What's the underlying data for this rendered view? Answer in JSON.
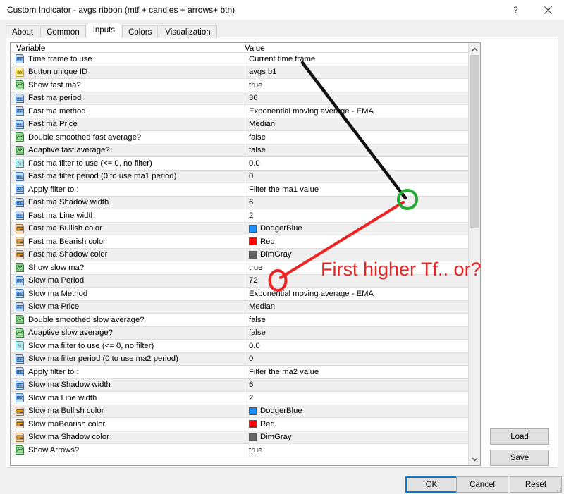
{
  "window": {
    "title": "Custom Indicator - avgs ribbon (mtf + candles + arrows+ btn)",
    "help_label": "?",
    "close_label": "×"
  },
  "tabs": [
    {
      "label": "About",
      "active": false
    },
    {
      "label": "Common",
      "active": false
    },
    {
      "label": "Inputs",
      "active": true
    },
    {
      "label": "Colors",
      "active": false
    },
    {
      "label": "Visualization",
      "active": false
    }
  ],
  "grid": {
    "headers": {
      "variable": "Variable",
      "value": "Value"
    },
    "rows": [
      {
        "icon": "int-123-icon",
        "label": "Time frame to use",
        "value": "Current time frame"
      },
      {
        "icon": "string-ab-icon",
        "label": "Button unique ID",
        "value": "avgs b1"
      },
      {
        "icon": "bool-chart-icon",
        "label": "Show fast ma?",
        "value": "true"
      },
      {
        "icon": "int-123-icon",
        "label": "Fast ma period",
        "value": "36"
      },
      {
        "icon": "int-123-icon",
        "label": "Fast ma method",
        "value": "Exponential moving average - EMA"
      },
      {
        "icon": "int-123-icon",
        "label": "Fast ma Price",
        "value": "Median"
      },
      {
        "icon": "bool-chart-icon",
        "label": "Double smoothed fast average?",
        "value": "false"
      },
      {
        "icon": "bool-chart-icon",
        "label": "Adaptive fast average?",
        "value": "false"
      },
      {
        "icon": "double-half-icon",
        "label": "Fast ma filter to use (<= 0, no filter)",
        "value": "0.0"
      },
      {
        "icon": "int-123-icon",
        "label": "Fast ma filter period (0 to use ma1 period)",
        "value": "0"
      },
      {
        "icon": "int-123-icon",
        "label": "Apply filter to :",
        "value": "Filter the ma1 value"
      },
      {
        "icon": "int-123-icon",
        "label": "Fast ma Shadow width",
        "value": "6"
      },
      {
        "icon": "int-123-icon",
        "label": "Fast ma Line width",
        "value": "2"
      },
      {
        "icon": "color-icon",
        "label": "Fast ma Bullish color",
        "value": "DodgerBlue",
        "swatch": "#1E90FF"
      },
      {
        "icon": "color-icon",
        "label": "Fast ma Bearish color",
        "value": "Red",
        "swatch": "#FF0000"
      },
      {
        "icon": "color-icon",
        "label": "Fast ma Shadow color",
        "value": "DimGray",
        "swatch": "#696969"
      },
      {
        "icon": "bool-chart-icon",
        "label": "Show slow ma?",
        "value": "true"
      },
      {
        "icon": "int-123-icon",
        "label": "Slow ma Period",
        "value": "72"
      },
      {
        "icon": "int-123-icon",
        "label": "Slow ma Method",
        "value": "Exponential moving average - EMA"
      },
      {
        "icon": "int-123-icon",
        "label": "Slow ma Price",
        "value": "Median"
      },
      {
        "icon": "bool-chart-icon",
        "label": "Double smoothed slow average?",
        "value": "false"
      },
      {
        "icon": "bool-chart-icon",
        "label": "Adaptive slow average?",
        "value": "false"
      },
      {
        "icon": "double-half-icon",
        "label": "Slow ma filter to use (<= 0, no filter)",
        "value": "0.0"
      },
      {
        "icon": "int-123-icon",
        "label": "Slow ma filter period (0 to use ma2 period)",
        "value": "0"
      },
      {
        "icon": "int-123-icon",
        "label": "Apply filter to :",
        "value": "Filter the ma2 value"
      },
      {
        "icon": "int-123-icon",
        "label": "Slow ma Shadow width",
        "value": "6"
      },
      {
        "icon": "int-123-icon",
        "label": "Slow ma Line width",
        "value": "2"
      },
      {
        "icon": "color-icon",
        "label": "Slow ma Bullish color",
        "value": "DodgerBlue",
        "swatch": "#1E90FF"
      },
      {
        "icon": "color-icon",
        "label": "Slow maBearish color",
        "value": "Red",
        "swatch": "#FF0000"
      },
      {
        "icon": "color-icon",
        "label": "Slow ma Shadow color",
        "value": "DimGray",
        "swatch": "#696969"
      },
      {
        "icon": "bool-chart-icon",
        "label": "Show Arrows?",
        "value": "true"
      }
    ]
  },
  "side_buttons": {
    "load": "Load",
    "save": "Save"
  },
  "dialog_buttons": {
    "ok": "OK",
    "cancel": "Cancel",
    "reset": "Reset"
  },
  "annotation": {
    "text": "First higher Tf.. or?",
    "text_color": "#ee2222",
    "line_black_color": "#111111",
    "line_red_color": "#ee2222",
    "circle_green_color": "#22aa33",
    "circle_red_color": "#ee2222"
  }
}
